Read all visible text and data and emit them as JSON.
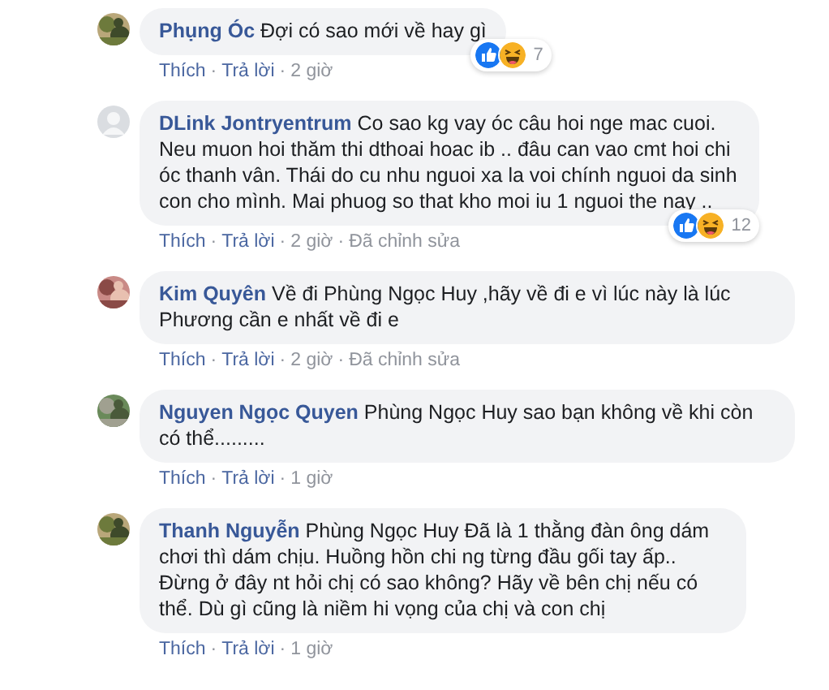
{
  "separator": "·",
  "comments": [
    {
      "avatar": {
        "kind": "picture"
      },
      "author": "Phụng Óc",
      "text": "Đợi có sao mới về hay gì",
      "reactions": {
        "icons": [
          {
            "kind": "like"
          },
          {
            "kind": "haha"
          }
        ],
        "count": "7"
      },
      "actions": [
        "Thích",
        "Trả lời",
        "2 giờ"
      ]
    },
    {
      "avatar": {
        "kind": "default"
      },
      "author": "DLink Jontryentrum",
      "text": "Co sao kg vay óc câu hoi nge mac cuoi. Neu muon hoi thăm thi dthoai hoac ib .. đâu can vao cmt hoi chi óc thanh vân. Thái do cu nhu nguoi xa la voi chính nguoi da sinh con cho mình. Mai phuog so that kho moi iu 1 nguoi the nay ..",
      "reactions": {
        "icons": [
          {
            "kind": "like"
          },
          {
            "kind": "haha"
          }
        ],
        "count": "12"
      },
      "actions": [
        "Thích",
        "Trả lời",
        "2 giờ",
        "Đã chỉnh sửa"
      ]
    },
    {
      "avatar": {
        "kind": "picture"
      },
      "author": "Kim Quyên",
      "text": "Về đi Phùng Ngọc Huy ,hãy về đi e vì lúc này là lúc Phương cần e nhất về đi e",
      "actions": [
        "Thích",
        "Trả lời",
        "2 giờ",
        "Đã chỉnh sửa"
      ]
    },
    {
      "avatar": {
        "kind": "picture"
      },
      "author": "Nguyen Ngọc Quyen",
      "text": "Phùng Ngọc Huy sao bạn không về khi còn có thể.........",
      "actions": [
        "Thích",
        "Trả lời",
        "1 giờ"
      ]
    },
    {
      "avatar": {
        "kind": "picture"
      },
      "author": "Thanh Nguyễn",
      "text": "Phùng Ngọc Huy Đã là 1 thằng đàn ông dám chơi thì dám chịu. Huồng hồn chi ng từng đầu gối tay ấp.. Đừng ở đây nt hỏi chị có sao không? Hãy về bên chị nếu có thể. Dù gì cũng là niềm hi vọng của chị và con chị",
      "actions": [
        "Thích",
        "Trả lời",
        "1 giờ"
      ]
    }
  ]
}
